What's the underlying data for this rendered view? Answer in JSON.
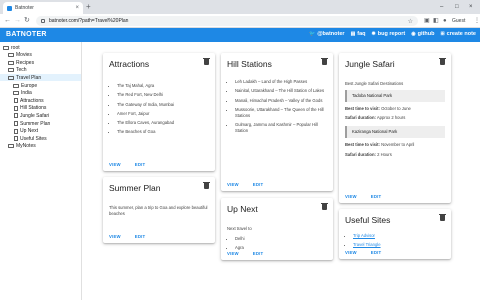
{
  "browser": {
    "tab_title": "Batnoter",
    "tab_close": "×",
    "new_tab": "+",
    "url": "batnoter.com/?path=Travel%20Plan",
    "guest_label": "Guest",
    "controls": {
      "minimize": "–",
      "maximize": "□",
      "close": "×",
      "back": "←",
      "forward": "→",
      "reload": "↻",
      "bookmark": "☆",
      "menu": "⋮"
    }
  },
  "appbar": {
    "brand": "BATNOTER",
    "links": [
      {
        "icon": "twitter-icon",
        "label": "@batnoter"
      },
      {
        "icon": "faq-icon",
        "label": "faq"
      },
      {
        "icon": "bug-icon",
        "label": "bug report"
      },
      {
        "icon": "github-icon",
        "label": "github"
      },
      {
        "icon": "add-note-icon",
        "label": "create note"
      }
    ]
  },
  "sidebar": {
    "items": [
      {
        "label": "root",
        "kind": "folder",
        "depth": 0,
        "selected": false
      },
      {
        "label": "Movies",
        "kind": "folder",
        "depth": 1,
        "selected": false
      },
      {
        "label": "Recipes",
        "kind": "folder",
        "depth": 1,
        "selected": false
      },
      {
        "label": "Tech",
        "kind": "folder",
        "depth": 1,
        "selected": false
      },
      {
        "label": "Travel Plan",
        "kind": "folder",
        "depth": 1,
        "selected": true
      },
      {
        "label": "Europe",
        "kind": "folder",
        "depth": 2,
        "selected": false
      },
      {
        "label": "India",
        "kind": "folder",
        "depth": 2,
        "selected": false
      },
      {
        "label": "Attractions",
        "kind": "note",
        "depth": 2,
        "selected": false
      },
      {
        "label": "Hill Stations",
        "kind": "note",
        "depth": 2,
        "selected": false
      },
      {
        "label": "Jungle Safari",
        "kind": "note",
        "depth": 2,
        "selected": false
      },
      {
        "label": "Summer Plan",
        "kind": "note",
        "depth": 2,
        "selected": false
      },
      {
        "label": "Up Next",
        "kind": "note",
        "depth": 2,
        "selected": false
      },
      {
        "label": "Useful Sites",
        "kind": "note",
        "depth": 2,
        "selected": false
      },
      {
        "label": "MyNotes",
        "kind": "folder",
        "depth": 1,
        "selected": false
      }
    ]
  },
  "actions": {
    "view": "VIEW",
    "edit": "EDIT"
  },
  "cards": {
    "attractions": {
      "title": "Attractions",
      "items": [
        "The Taj Mahal, Agra",
        "The Red Fort, New Delhi",
        "The Gateway of India, Mumbai",
        "Amer Fort, Jaipur",
        "The Ellora Caves, Aurangabad",
        "The Beaches of Goa"
      ]
    },
    "summer_plan": {
      "title": "Summer Plan",
      "text": "This summer, plan a trip to Goa and explore beautiful beaches"
    },
    "hill_stations": {
      "title": "Hill Stations",
      "items": [
        "Leh Ladakh – Land of the High Passes",
        "Nainital, Uttarakhand – The Hill Station of Lakes",
        "Manali, Himachal Pradesh – Valley of the Gods",
        "Mussoorie, Uttarakhand – The Queen of the Hill Stations",
        "Gulmarg, Jammu and Kashmir – Popular Hill Station"
      ]
    },
    "up_next": {
      "title": "Up Next",
      "intro": "Next travel to",
      "items": [
        "Delhi",
        "Agra"
      ]
    },
    "jungle_safari": {
      "title": "Jungle Safari",
      "intro": "Best Jungle Safari Destinations",
      "parks": [
        {
          "name": "Tadoba National Park",
          "best_label": "Best time to visit:",
          "best_value": "October to June",
          "duration_label": "Safari duration:",
          "duration_value": "Approx 2 hours"
        },
        {
          "name": "Kaziranga National Park",
          "best_label": "Best time to visit:",
          "best_value": "November to April",
          "duration_label": "Safari duration:",
          "duration_value": "2 Hours"
        }
      ]
    },
    "useful_sites": {
      "title": "Useful Sites",
      "links": [
        "Trip Advisor",
        "Travel Triangle"
      ]
    }
  }
}
